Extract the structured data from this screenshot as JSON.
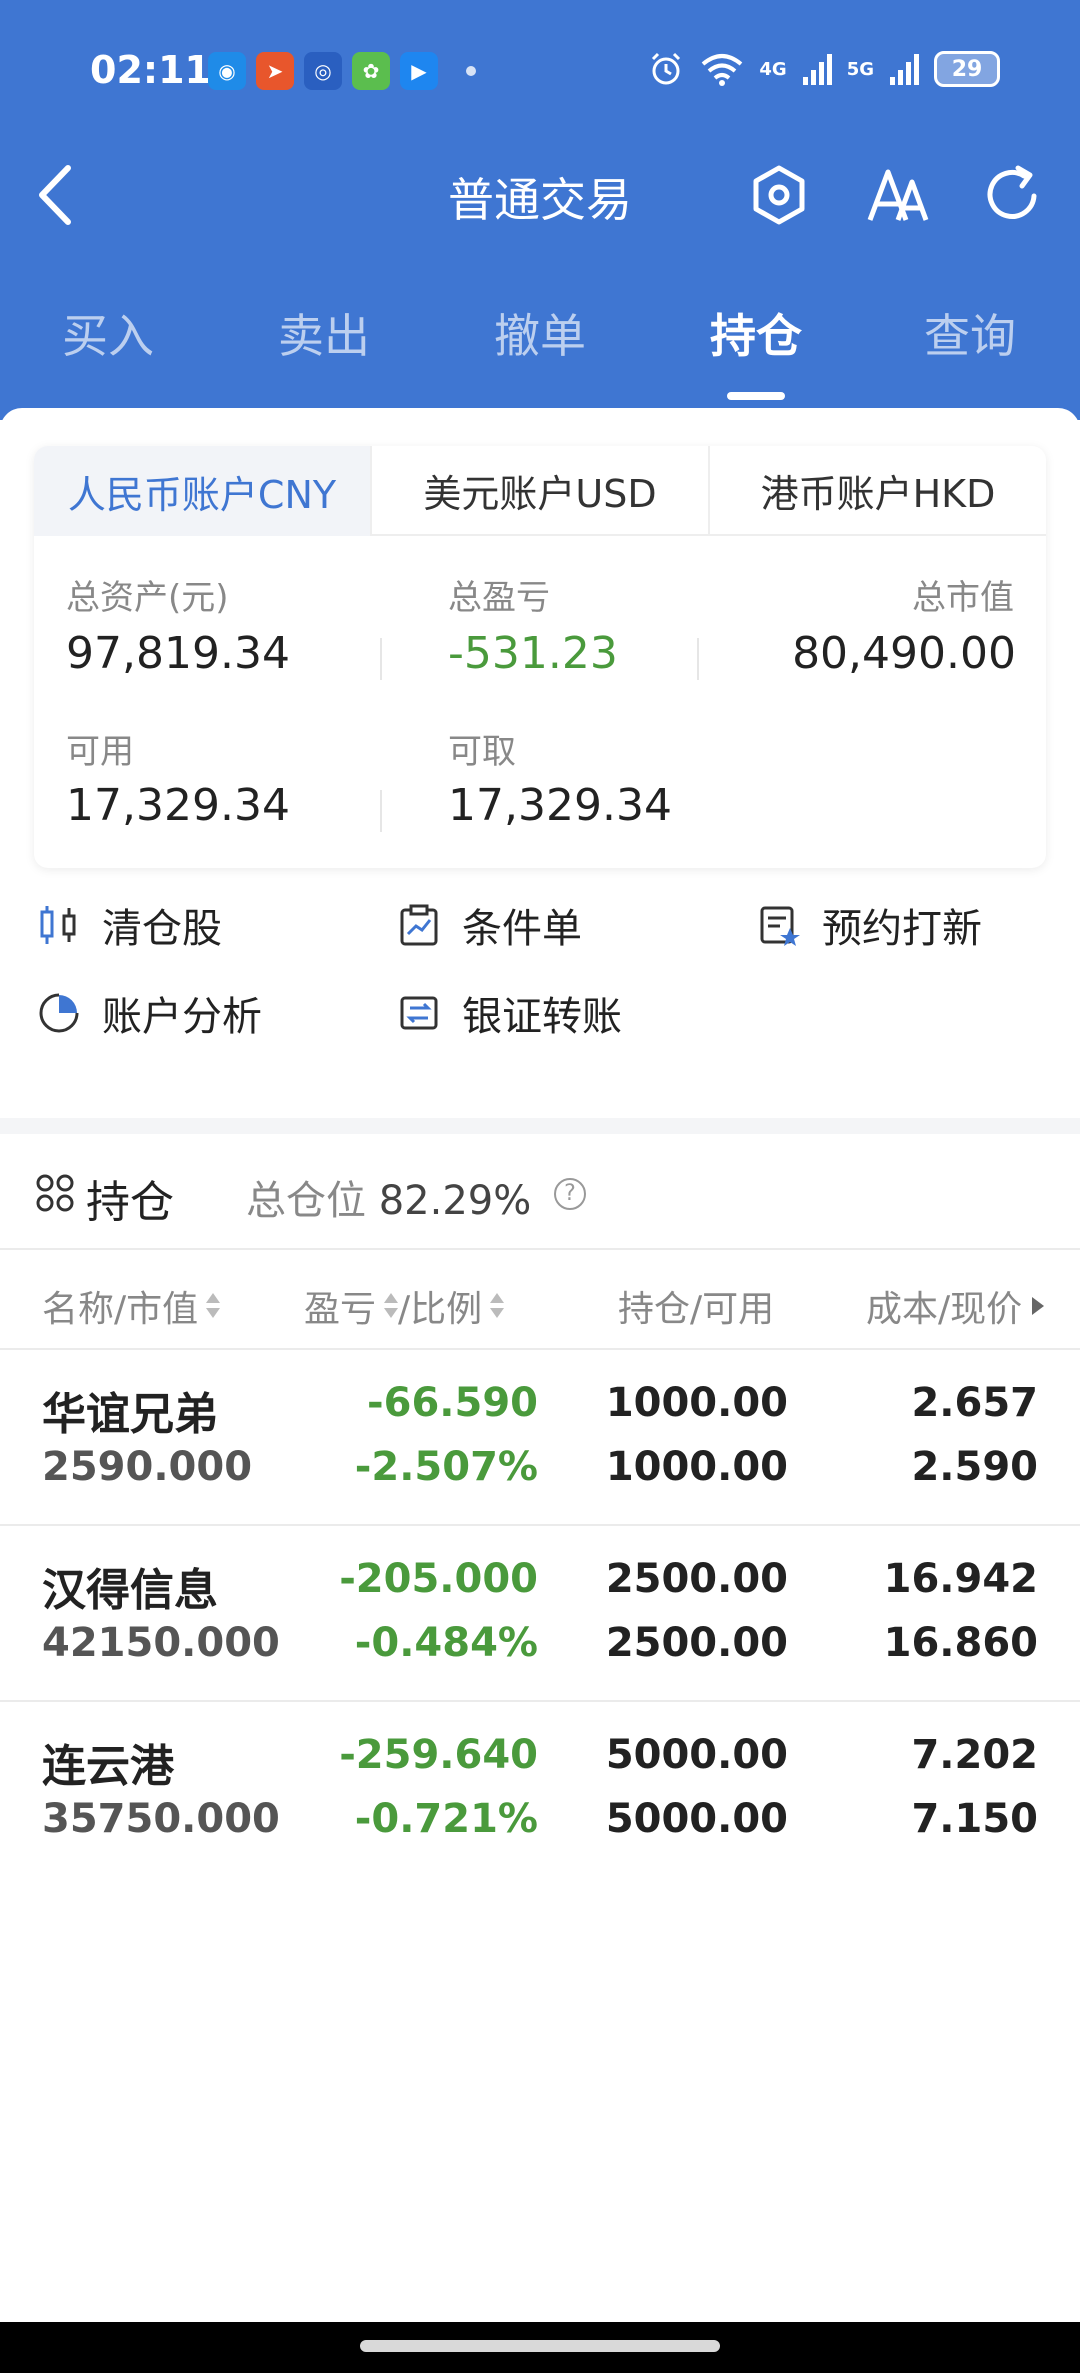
{
  "status_bar": {
    "time": "02:11",
    "battery": "29",
    "network": [
      "4G",
      "5G"
    ],
    "notification_icons": [
      "app-icon",
      "app-icon",
      "app-icon",
      "app-icon",
      "app-icon"
    ]
  },
  "header": {
    "title": "普通交易"
  },
  "tabs": [
    {
      "label": "买入"
    },
    {
      "label": "卖出"
    },
    {
      "label": "撤单"
    },
    {
      "label": "持仓"
    },
    {
      "label": "查询"
    }
  ],
  "account_tabs": [
    {
      "label": "人民币账户CNY"
    },
    {
      "label": "美元账户USD"
    },
    {
      "label": "港币账户HKD"
    }
  ],
  "summary": {
    "total_assets_label": "总资产(元)",
    "total_assets": "97,819.34",
    "pnl_label": "总盈亏",
    "pnl": "-531.23",
    "market_value_label": "总市值",
    "market_value": "80,490.00",
    "available_label": "可用",
    "available": "17,329.34",
    "withdrawable_label": "可取",
    "withdrawable": "17,329.34"
  },
  "actions": [
    {
      "label": "清仓股",
      "icon": "clear-stock-icon"
    },
    {
      "label": "条件单",
      "icon": "conditional-order-icon"
    },
    {
      "label": "预约打新",
      "icon": "ipo-subscribe-icon"
    },
    {
      "label": "账户分析",
      "icon": "pie-chart-icon"
    },
    {
      "label": "银证转账",
      "icon": "transfer-icon"
    }
  ],
  "holdings": {
    "title": "持仓",
    "position_label": "总仓位",
    "position_value": "82.29%",
    "columns": [
      "名称/市值",
      "盈亏",
      "/比例",
      "持仓/可用",
      "成本/现价"
    ],
    "rows": [
      {
        "name": "华谊兄弟",
        "market_value": "2590.000",
        "pnl": "-66.590",
        "ratio": "-2.507%",
        "holding": "1000.00",
        "available": "1000.00",
        "cost": "2.657",
        "price": "2.590"
      },
      {
        "name": "汉得信息",
        "market_value": "42150.000",
        "pnl": "-205.000",
        "ratio": "-0.484%",
        "holding": "2500.00",
        "available": "2500.00",
        "cost": "16.942",
        "price": "16.860"
      },
      {
        "name": "连云港",
        "market_value": "35750.000",
        "pnl": "-259.640",
        "ratio": "-0.721%",
        "holding": "5000.00",
        "available": "5000.00",
        "cost": "7.202",
        "price": "7.150"
      }
    ]
  },
  "colors": {
    "primary": "#3F76D2",
    "loss": "#4A9A3C"
  }
}
